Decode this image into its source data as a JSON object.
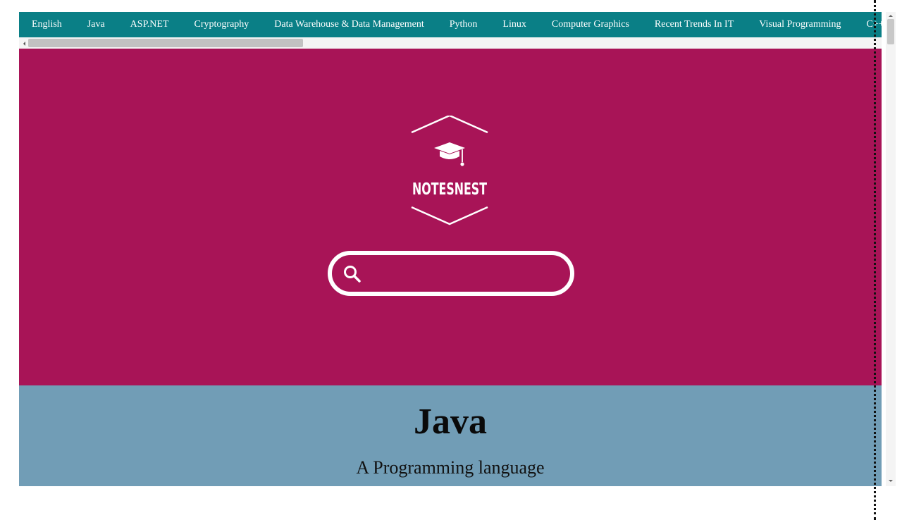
{
  "nav": {
    "items": [
      {
        "label": "English"
      },
      {
        "label": "Java"
      },
      {
        "label": "ASP.NET"
      },
      {
        "label": "Cryptography"
      },
      {
        "label": "Data Warehouse & Data Management"
      },
      {
        "label": "Python"
      },
      {
        "label": "Linux"
      },
      {
        "label": "Computer Graphics"
      },
      {
        "label": "Recent Trends In IT"
      },
      {
        "label": "Visual Programming"
      },
      {
        "label": "C++"
      }
    ]
  },
  "hero": {
    "logo_text": "NOTESNEST",
    "logo_icon": "graduation-cap-icon",
    "search": {
      "value": "",
      "placeholder": "",
      "icon": "search-icon"
    }
  },
  "banner": {
    "title": "Java",
    "subtitle": "A Programming language"
  },
  "colors": {
    "nav_bg": "#0a7f86",
    "hero_bg": "#a81457",
    "banner_bg": "#719db6"
  }
}
